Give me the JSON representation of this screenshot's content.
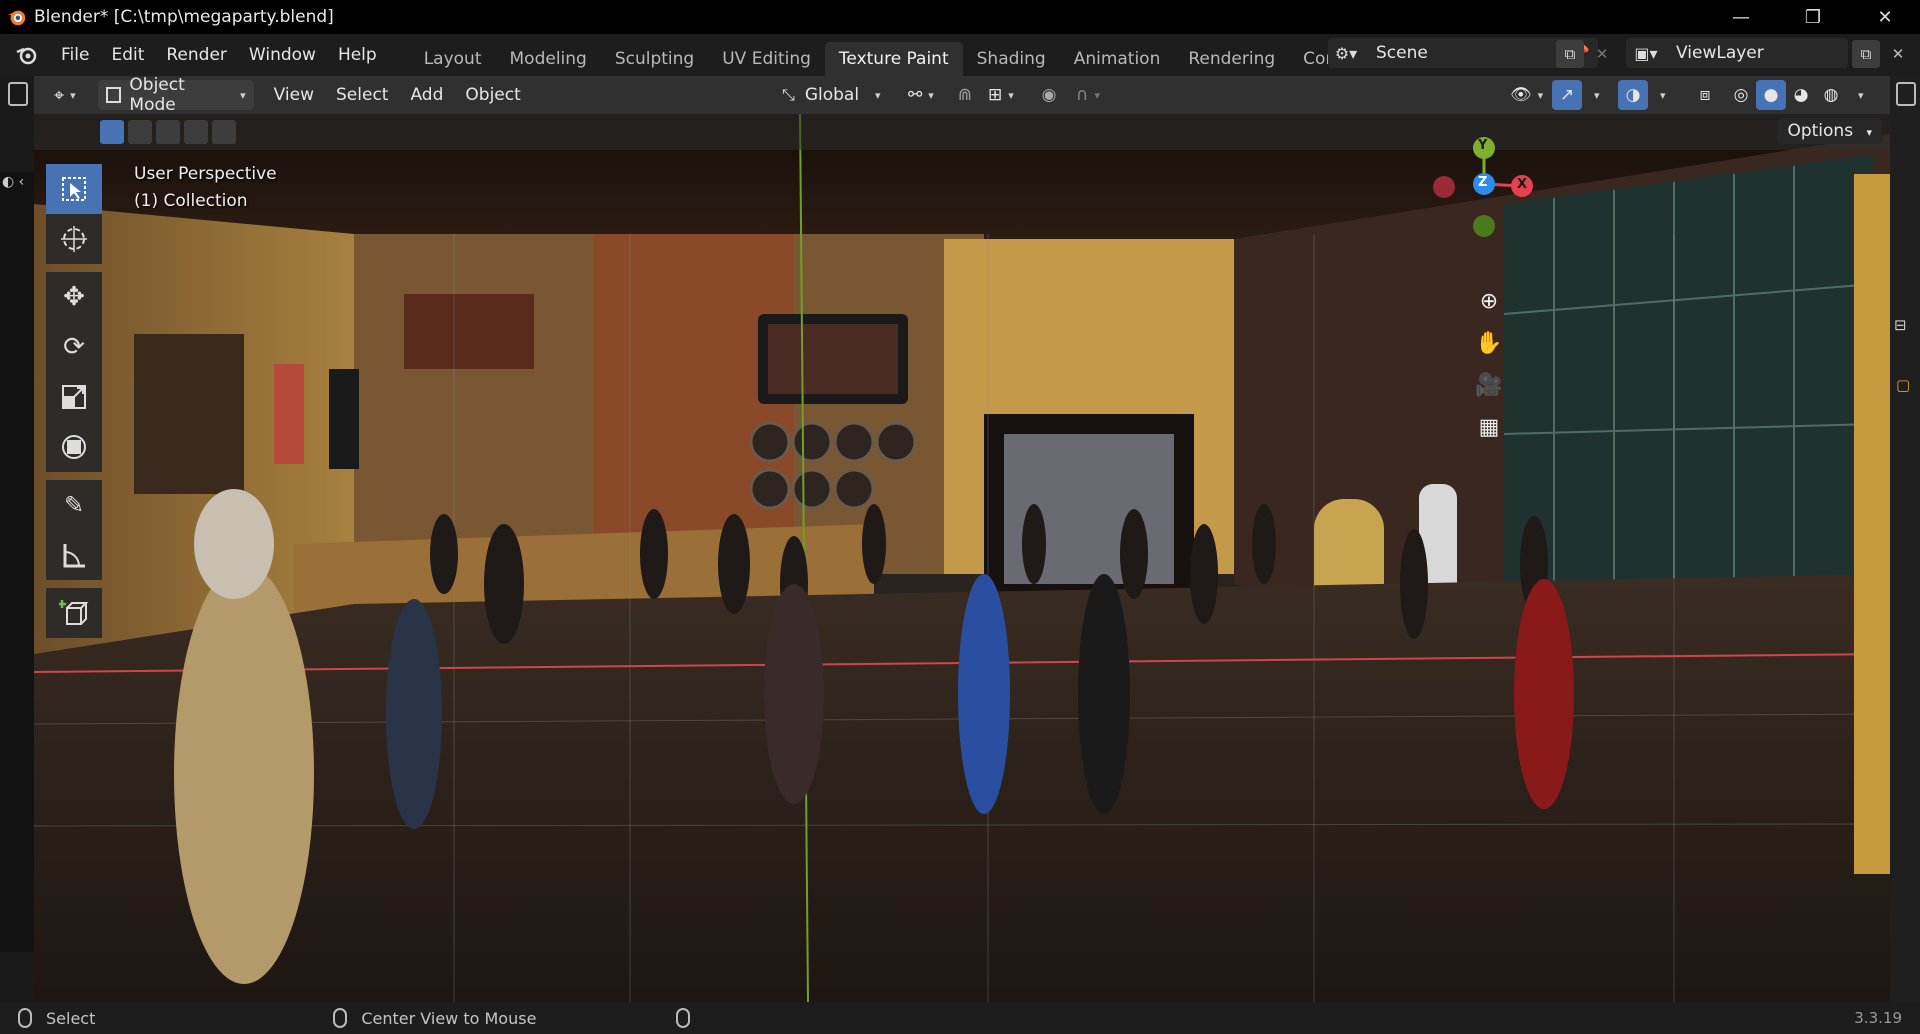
{
  "window": {
    "title": "Blender* [C:\\tmp\\megaparty.blend]",
    "minimize": "—",
    "maximize": "❐",
    "close": "✕"
  },
  "menu": [
    "File",
    "Edit",
    "Render",
    "Window",
    "Help"
  ],
  "workspaces": [
    {
      "label": "Layout"
    },
    {
      "label": "Modeling"
    },
    {
      "label": "Sculpting"
    },
    {
      "label": "UV Editing"
    },
    {
      "label": "Texture Paint",
      "active": true
    },
    {
      "label": "Shading"
    },
    {
      "label": "Animation"
    },
    {
      "label": "Rendering"
    },
    {
      "label": "Compc"
    }
  ],
  "scene": {
    "name": "Scene"
  },
  "view_layer": {
    "name": "ViewLayer"
  },
  "viewport_header": {
    "mode": "Object Mode",
    "menus": [
      "View",
      "Select",
      "Add",
      "Object"
    ],
    "transform_orientation": "Global"
  },
  "viewport": {
    "perspective": "User Perspective",
    "collection": "(1) Collection",
    "options_label": "Options",
    "gizmo": {
      "y": "Y",
      "z": "Z",
      "x": "X"
    },
    "toolbar": [
      {
        "name": "select-box-tool",
        "active": true
      },
      {
        "name": "cursor-tool"
      },
      {
        "name": "move-tool"
      },
      {
        "name": "rotate-tool"
      },
      {
        "name": "scale-tool"
      },
      {
        "name": "transform-tool"
      },
      {
        "name": "annotate-tool"
      },
      {
        "name": "measure-tool"
      },
      {
        "name": "add-cube-tool"
      }
    ]
  },
  "status": {
    "left_action": "Select",
    "middle_action": "Center View to Mouse",
    "version": "3.3.19"
  },
  "colors": {
    "accent": "#4772b3",
    "axis_x": "#e5424f",
    "axis_y": "#7fb02d",
    "axis_z": "#2e8bea",
    "header_bg": "#303030",
    "topbar_bg": "#1d1d1d"
  }
}
